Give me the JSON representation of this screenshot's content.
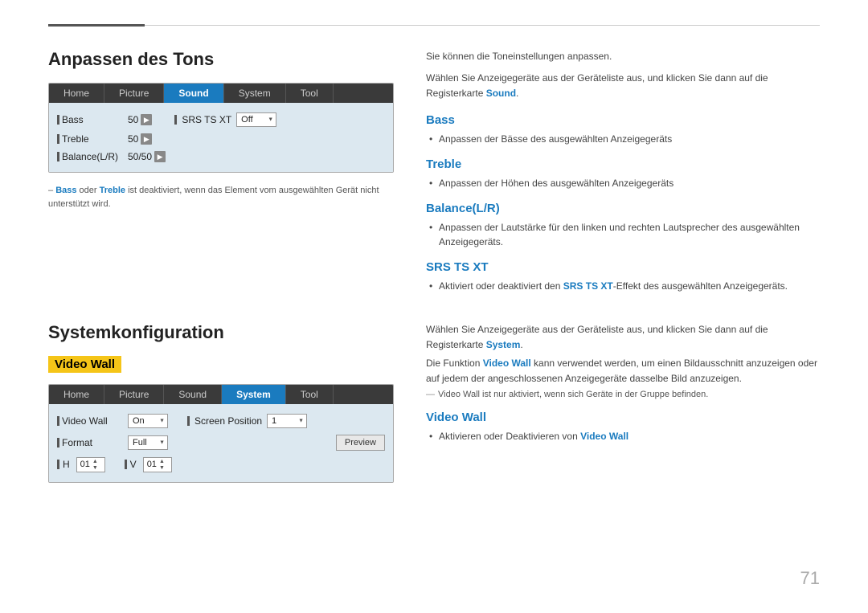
{
  "page": {
    "number": "71"
  },
  "top_rule": {},
  "section1": {
    "title": "Anpassen des Tons",
    "panel": {
      "tabs": [
        {
          "label": "Home",
          "active": false
        },
        {
          "label": "Picture",
          "active": false
        },
        {
          "label": "Sound",
          "active": true
        },
        {
          "label": "System",
          "active": false
        },
        {
          "label": "Tool",
          "active": false
        }
      ],
      "rows": [
        {
          "label": "Bass",
          "value": "50",
          "has_arrow": true
        },
        {
          "label": "SRS TS XT",
          "value": "Off",
          "has_dropdown": true
        },
        {
          "label": "Treble",
          "value": "50",
          "has_arrow": true
        },
        {
          "label": "Balance(L/R)",
          "value": "50/50",
          "has_arrow": true
        }
      ]
    },
    "note": "– Bass oder Treble ist deaktiviert, wenn das Element vom ausgewählten Gerät nicht unterstützt wird.",
    "note_highlight1": "Bass",
    "note_highlight2": "Treble"
  },
  "section1_right": {
    "intro1": "Sie können die Toneinstellungen anpassen.",
    "intro2": "Wählen Sie Anzeigegeräte aus der Geräteliste aus, und klicken Sie dann auf die Registerkarte Sound.",
    "intro2_link": "Sound",
    "features": [
      {
        "id": "bass",
        "title": "Bass",
        "items": [
          "Anpassen der Bässe des ausgewählten Anzeigegeräts"
        ]
      },
      {
        "id": "treble",
        "title": "Treble",
        "items": [
          "Anpassen der Höhen des ausgewählten Anzeigegeräts"
        ]
      },
      {
        "id": "balance",
        "title": "Balance(L/R)",
        "items": [
          "Anpassen der Lautstärke für den linken und rechten Lautsprecher des ausgewählten Anzeigegeräts."
        ]
      },
      {
        "id": "srs",
        "title": "SRS TS XT",
        "items_html": "Aktiviert oder deaktiviert den SRS TS XT-Effekt des ausgewählten Anzeigegeräts.",
        "link_text": "SRS TS XT"
      }
    ]
  },
  "section2": {
    "title": "Systemkonfiguration",
    "highlight_label": "Video Wall",
    "panel": {
      "tabs": [
        {
          "label": "Home",
          "active": false
        },
        {
          "label": "Picture",
          "active": false
        },
        {
          "label": "Sound",
          "active": false
        },
        {
          "label": "System",
          "active": true
        },
        {
          "label": "Tool",
          "active": false
        }
      ],
      "rows": [
        {
          "label": "Video Wall",
          "value": "On",
          "has_dropdown": true,
          "label2": "Screen Position",
          "value2": "1",
          "has_dropdown2": true
        },
        {
          "label": "Format",
          "value": "Full",
          "has_dropdown": true,
          "has_preview": true
        },
        {
          "label": "H",
          "value": "01",
          "label2": "V",
          "value2": "01",
          "has_stepper": true
        }
      ]
    }
  },
  "section2_right": {
    "intro1": "Wählen Sie Anzeigegeräte aus der Geräteliste aus, und klicken Sie dann auf die Registerkarte System.",
    "intro1_link": "System",
    "intro2": "Die Funktion Video Wall kann verwendet werden, um einen Bildausschnitt anzuzeigen oder auf jedem der angeschlossenen Anzeigegeräte dasselbe Bild anzuzeigen.",
    "intro2_link": "Video Wall",
    "note": "Video Wall ist nur aktiviert, wenn sich Geräte in der Gruppe befinden.",
    "note_link": "Video Wall",
    "feature_title": "Video Wall",
    "feature_item": "Aktivieren oder Deaktivieren von Video Wall",
    "feature_item_link": "Video Wall"
  }
}
